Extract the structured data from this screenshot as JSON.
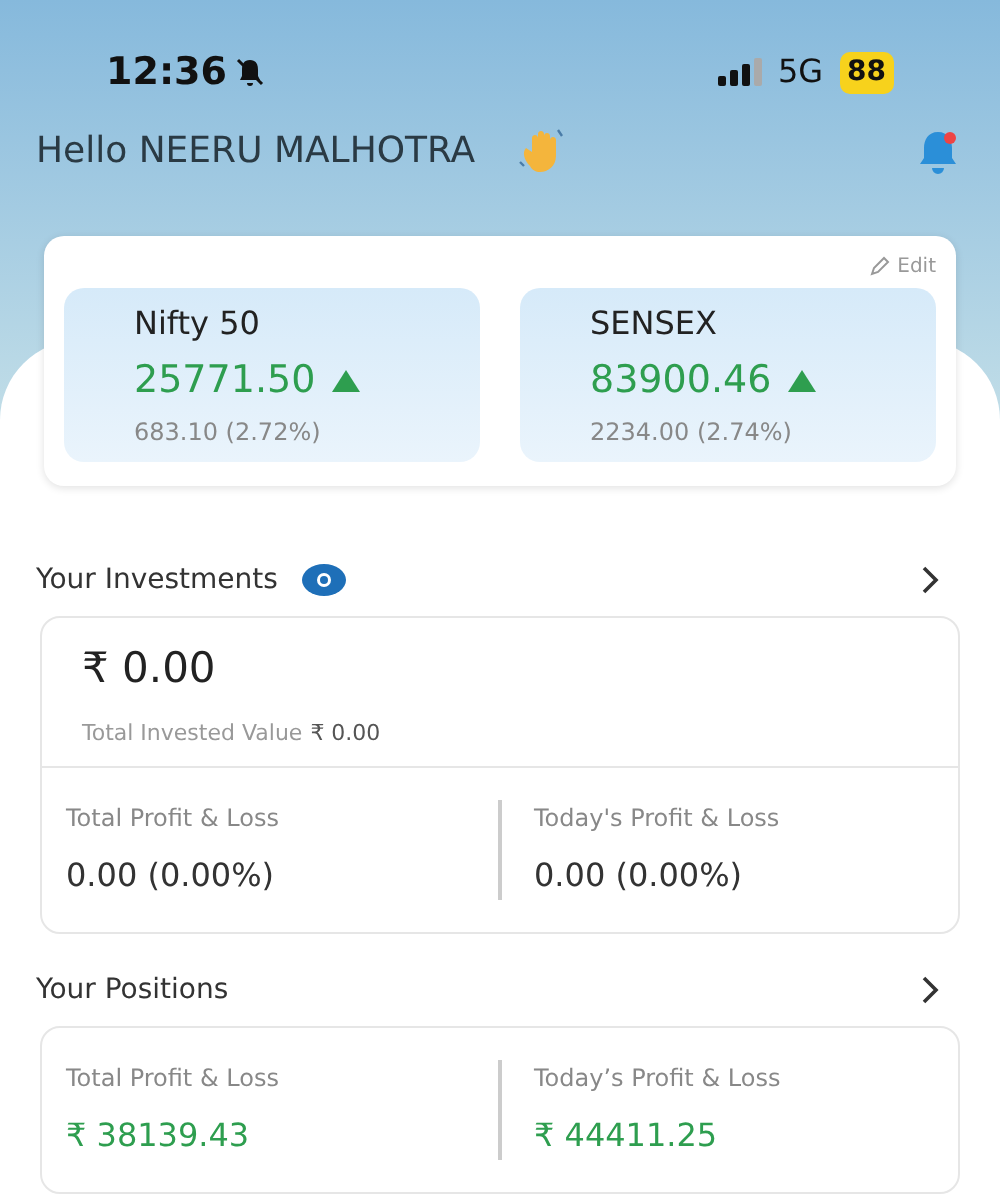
{
  "status_bar": {
    "time": "12:36",
    "network": "5G",
    "battery": "88"
  },
  "greeting": "Hello NEERU MALHOTRA",
  "indices_card": {
    "edit": "Edit",
    "indices": [
      {
        "name": "Nifty 50",
        "value": "25771.50",
        "gain": true,
        "change": "683.10 (2.72%)"
      },
      {
        "name": "SENSEX",
        "value": "83900.46",
        "gain": true,
        "change": "2234.00 (2.74%)"
      }
    ]
  },
  "investments": {
    "title": "Your Investments",
    "amount": "₹ 0.00",
    "invested_label": "Total Invested Value",
    "invested_value": "₹ 0.00",
    "stats": [
      {
        "label": "Total Profit & Loss",
        "value": "0.00 (0.00%)",
        "gain": false
      },
      {
        "label": "Today's Profit & Loss",
        "value": "0.00 (0.00%)",
        "gain": false
      }
    ]
  },
  "positions": {
    "title": "Your Positions",
    "stats": [
      {
        "label": "Total Profit & Loss",
        "value": "₹ 38139.43",
        "gain": true
      },
      {
        "label": "Today’s Profit & Loss",
        "value": "₹ 44411.25",
        "gain": true
      }
    ]
  }
}
